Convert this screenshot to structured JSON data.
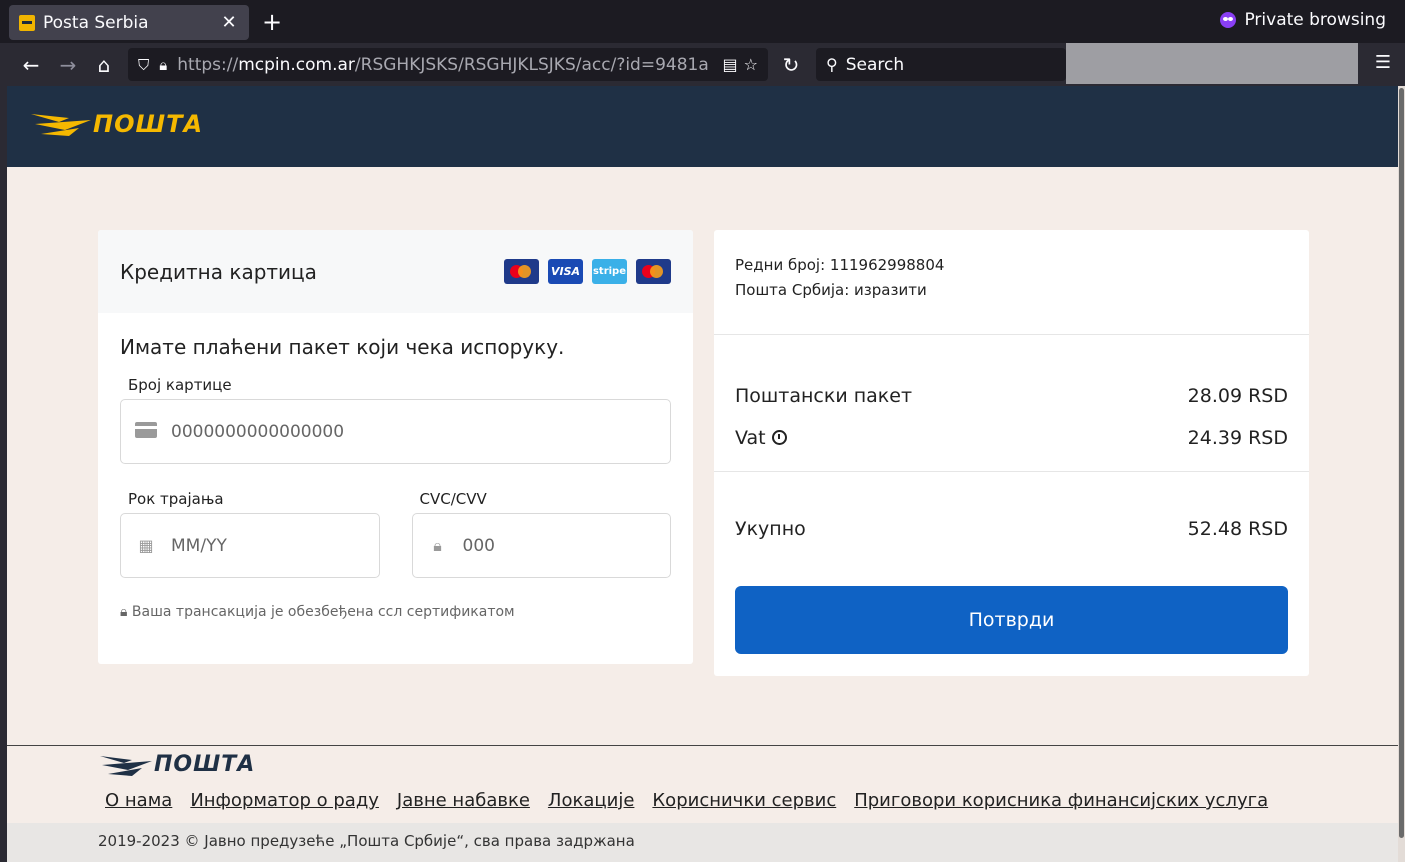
{
  "browser": {
    "tab_title": "Posta Serbia",
    "tab_close": "✕",
    "new_tab": "+",
    "private_label": "Private browsing",
    "url_scheme": "https://",
    "url_host": "mcpin.com.ar",
    "url_path": "/RSGHKJSKS/RSGHJKLSJKS/acc/?id=9481a",
    "search_placeholder": "Search"
  },
  "site": {
    "logo_text": "ПОШТА"
  },
  "card_panel": {
    "title": "Кредитна картица",
    "lead": "Имате плаћени пакет који чека испоруку.",
    "card_number_label": "Број картице",
    "card_number_placeholder": "0000000000000000",
    "expiry_label": "Рок трајања",
    "expiry_placeholder": "MM/YY",
    "cvc_label": "CVC/CVV",
    "cvc_placeholder": "000",
    "secure_note": "Ваша трансакција је обезбеђена ссл сертификатом",
    "brands": [
      "VISA",
      "stripe"
    ]
  },
  "summary": {
    "order_line": "Редни број: 111962998804",
    "sender_line": "Пошта Србија: изразити",
    "items": [
      {
        "label": "Поштански пакет",
        "amount": "28.09 RSD"
      },
      {
        "label": "Vat",
        "amount": "24.39 RSD"
      }
    ],
    "total_label": "Укупно",
    "total_amount": "52.48 RSD",
    "confirm_label": "Потврди"
  },
  "footer": {
    "logo_text": "ПОШТА",
    "links": [
      "О нама",
      "Информатор о раду",
      "Јавне набавке",
      "Локације",
      "Кориснички сервис",
      "Приговори корисника финансијских услуга"
    ],
    "copyright": "2019-2023 © Јавно предузеће „Пошта Србије“, сва права задржана"
  },
  "colors": {
    "header_bg": "#1f3045",
    "page_bg": "#f5ede8",
    "brand_yellow": "#f5b800",
    "button_blue": "#0f62c4"
  }
}
